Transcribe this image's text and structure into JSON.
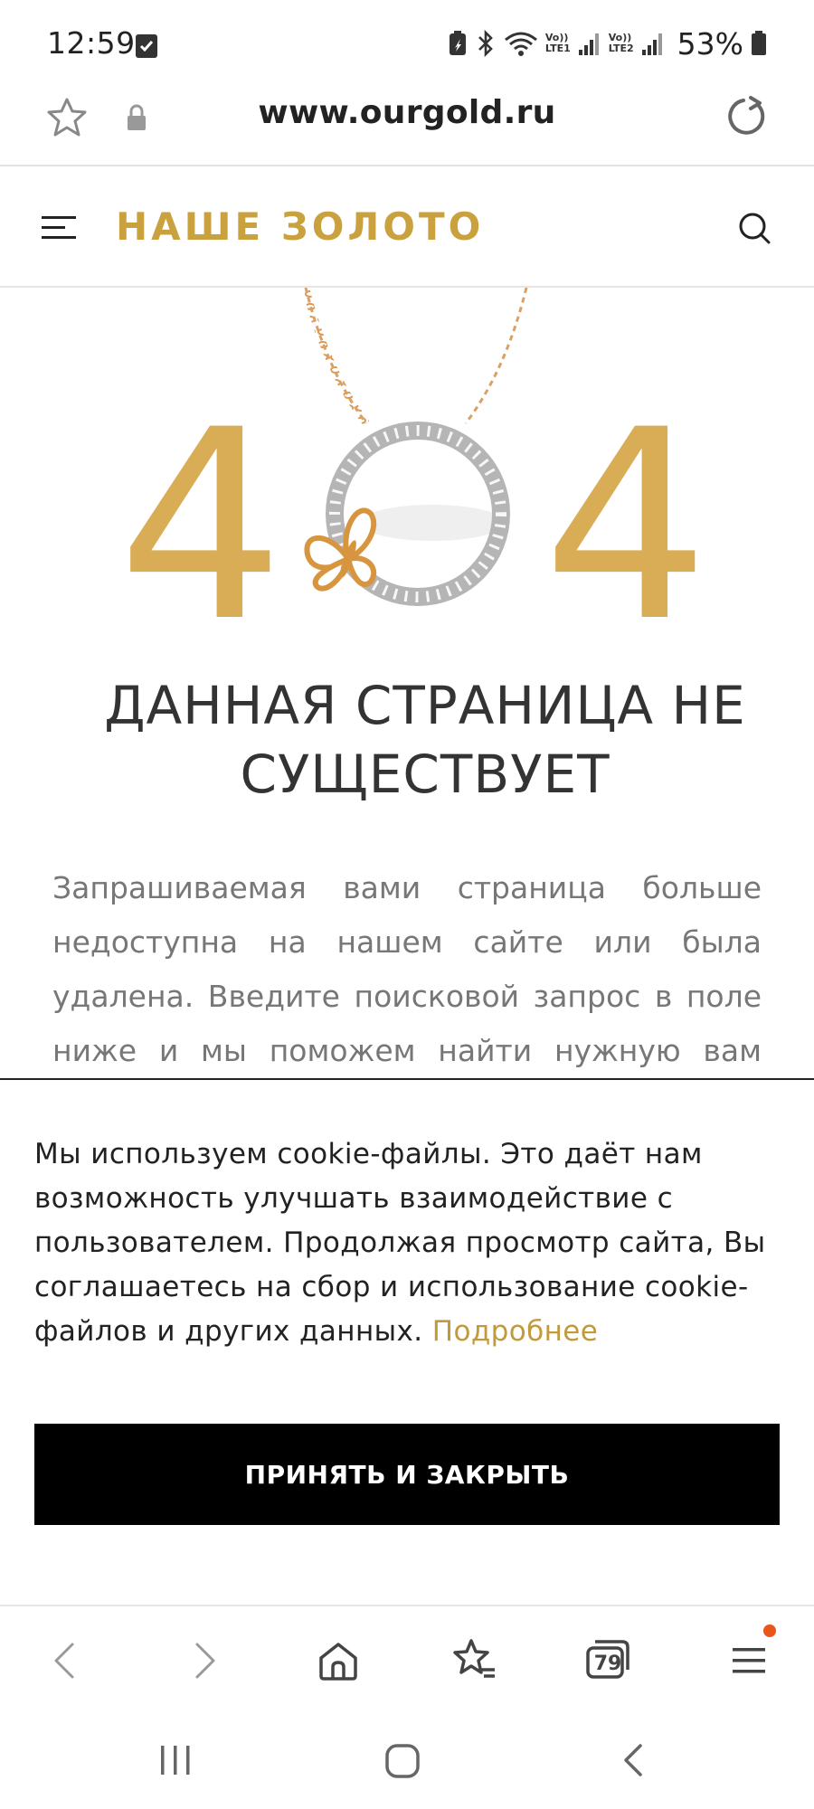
{
  "status_bar": {
    "time": "12:59",
    "battery": "53%",
    "sim1_label": "LTE1",
    "sim2_label": "LTE2",
    "volte_label": "Vo))"
  },
  "browser": {
    "url": "www.ourgold.ru"
  },
  "site": {
    "brand": "НАШЕ ЗОЛОТО",
    "brand_color": "#c9a13f"
  },
  "error_page": {
    "digit_left": "4",
    "digit_right": "4",
    "title": "ДАННАЯ СТРАНИЦА НЕ СУЩЕСТВУЕТ",
    "description": "Запрашиваемая вами страница больше недоступна на нашем сайте или была удалена. Введите поисковой запрос в поле ниже и мы поможем найти нужную вам"
  },
  "cookie_banner": {
    "text": "Мы используем cookie-файлы. Это даёт нам возможность улучшать взаимодействие с пользователем. Продолжая просмотр сайта, Вы соглашаетесь на сбор и использование cookie-файлов и других данных.",
    "link_label": "Подробнее",
    "accept_label": "ПРИНЯТЬ И ЗАКРЫТЬ",
    "link_color": "#c29a3c"
  },
  "toolbar": {
    "tabs_count": "79",
    "notification_color": "#e8561b"
  },
  "icons": {
    "status": [
      "checkbox-notification-icon",
      "battery-saver-icon",
      "bluetooth-icon",
      "wifi-icon",
      "signal-icon",
      "battery-icon"
    ],
    "address_bar": [
      "bookmark-star-icon",
      "lock-icon",
      "reload-icon"
    ],
    "header": [
      "hamburger-menu-icon",
      "search-icon"
    ],
    "toolbar": [
      "back-icon",
      "forward-icon",
      "home-icon",
      "bookmarks-icon",
      "tabs-icon",
      "menu-icon"
    ],
    "system_nav": [
      "recents-icon",
      "home-nav-icon",
      "back-nav-icon"
    ]
  }
}
